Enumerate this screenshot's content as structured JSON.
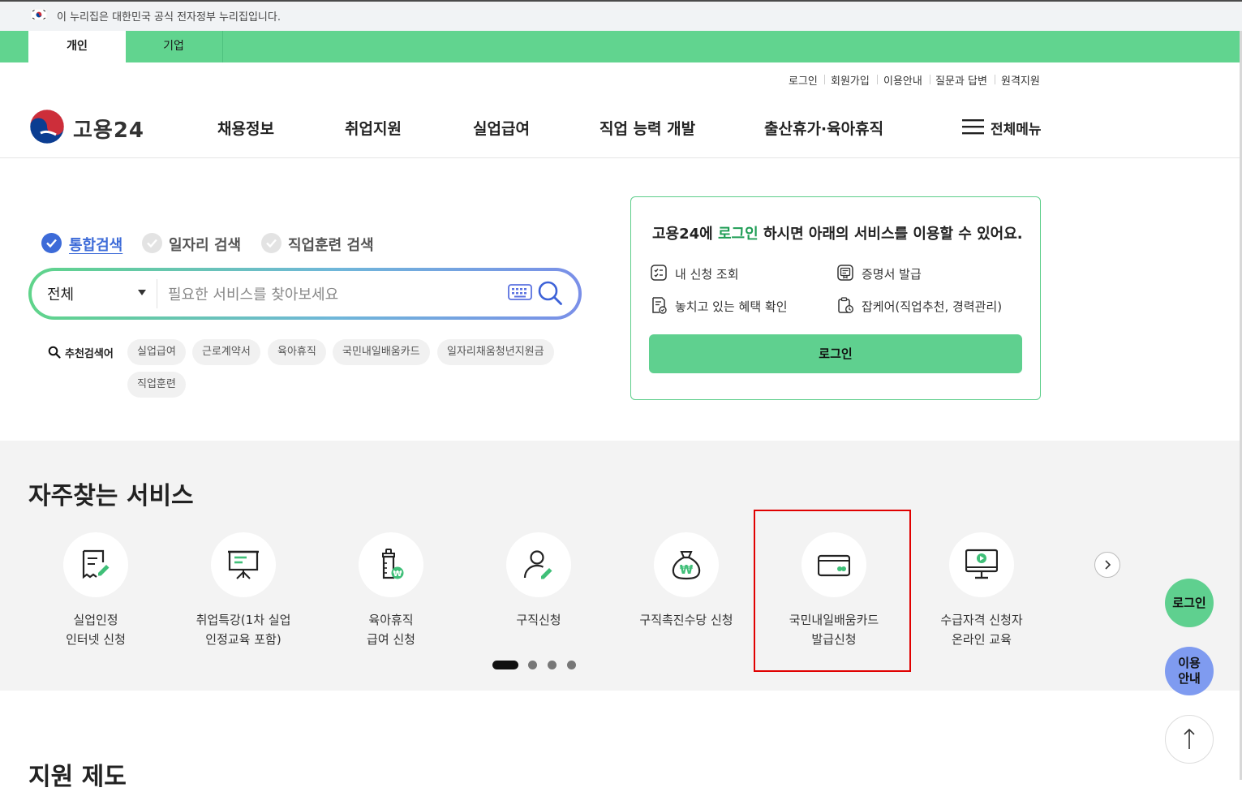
{
  "gov_banner": {
    "text": "이 누리집은 대한민국 공식 전자정부 누리집입니다."
  },
  "user_tabs": [
    {
      "label": "개인",
      "active": true
    },
    {
      "label": "기업",
      "active": false
    }
  ],
  "utility_links": [
    "로그인",
    "회원가입",
    "이용안내",
    "질문과 답변",
    "원격지원"
  ],
  "logo": {
    "text": "고용24"
  },
  "nav": [
    "채용정보",
    "취업지원",
    "실업급여",
    "직업 능력 개발",
    "출산휴가·육아휴직"
  ],
  "all_menu": {
    "label": "전체메뉴",
    "icon": "hamburger-icon"
  },
  "search": {
    "types": [
      {
        "label": "통합검색",
        "selected": true
      },
      {
        "label": "일자리 검색",
        "selected": false
      },
      {
        "label": "직업훈련 검색",
        "selected": false
      }
    ],
    "scope": "전체",
    "placeholder": "필요한 서비스를 찾아보세요",
    "recommend_label": "추천검색어",
    "keywords": [
      "실업급여",
      "근로계약서",
      "육아휴직",
      "국민내일배움카드",
      "일자리채움청년지원금",
      "직업훈련"
    ]
  },
  "login_card": {
    "title_prefix": "고용24에 ",
    "title_highlight": "로그인",
    "title_suffix": " 하시면 아래의 서비스를 이용할 수 있어요.",
    "items": [
      {
        "label": "내 신청 조회",
        "icon": "application-list-icon"
      },
      {
        "label": "증명서 발급",
        "icon": "certificate-icon"
      },
      {
        "label": "놓치고 있는 혜택 확인",
        "icon": "benefit-check-icon"
      },
      {
        "label": "잡케어(직업추천, 경력관리)",
        "icon": "jobcare-icon"
      }
    ],
    "button": "로그인"
  },
  "frequent_services": {
    "title": "자주찾는 서비스",
    "items": [
      {
        "line1": "실업인정",
        "line2": "인터넷 신청",
        "icon": "document-pen-icon"
      },
      {
        "line1": "취업특강(1차 실업",
        "line2": "인정교육 포함)",
        "icon": "presentation-board-icon"
      },
      {
        "line1": "육아휴직",
        "line2": "급여 신청",
        "icon": "baby-bottle-icon"
      },
      {
        "line1": "구직신청",
        "line2": "",
        "icon": "person-pen-icon"
      },
      {
        "line1": "구직촉진수당 신청",
        "line2": "",
        "icon": "money-bag-icon"
      },
      {
        "line1": "국민내일배움카드",
        "line2": "발급신청",
        "icon": "card-icon"
      },
      {
        "line1": "수급자격 신청자",
        "line2": "온라인 교육",
        "icon": "monitor-play-icon"
      }
    ],
    "pagination": {
      "current": 1,
      "total": 4
    },
    "colors": {
      "accent": "#5fd08f",
      "highlight": "#e00000"
    }
  },
  "floating": {
    "login": "로그인",
    "guide_line1": "이용",
    "guide_line2": "안내"
  },
  "support": {
    "title": "지원 제도"
  }
}
